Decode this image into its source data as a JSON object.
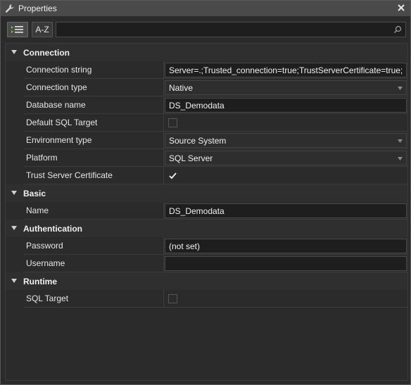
{
  "window": {
    "title": "Properties"
  },
  "toolbar": {
    "categorized_label": "categorized",
    "az_label": "A-Z",
    "search_placeholder": "",
    "search_value": ""
  },
  "categories": [
    {
      "label": "Connection",
      "items": [
        {
          "name": "Connection string",
          "type": "text",
          "value": "Server=.;Trusted_connection=true;TrustServerCertificate=true;"
        },
        {
          "name": "Connection type",
          "type": "select",
          "value": "Native"
        },
        {
          "name": "Database name",
          "type": "text",
          "value": "DS_Demodata"
        },
        {
          "name": "Default SQL Target",
          "type": "checkbox",
          "checked": false
        },
        {
          "name": "Environment type",
          "type": "select",
          "value": "Source System"
        },
        {
          "name": "Platform",
          "type": "select",
          "value": "SQL Server"
        },
        {
          "name": "Trust Server Certificate",
          "type": "checkbox",
          "checked": true
        }
      ]
    },
    {
      "label": "Basic",
      "items": [
        {
          "name": "Name",
          "type": "text",
          "value": "DS_Demodata"
        }
      ]
    },
    {
      "label": "Authentication",
      "items": [
        {
          "name": "Password",
          "type": "text",
          "value": "(not set)"
        },
        {
          "name": "Username",
          "type": "text",
          "value": ""
        }
      ]
    },
    {
      "label": "Runtime",
      "items": [
        {
          "name": "SQL Target",
          "type": "checkbox",
          "checked": false
        }
      ]
    }
  ],
  "colors": {
    "background": "#2b2b2b",
    "titlebar": "#4a4a4a",
    "field": "#1e1e1e",
    "text": "#e6e6e6"
  }
}
